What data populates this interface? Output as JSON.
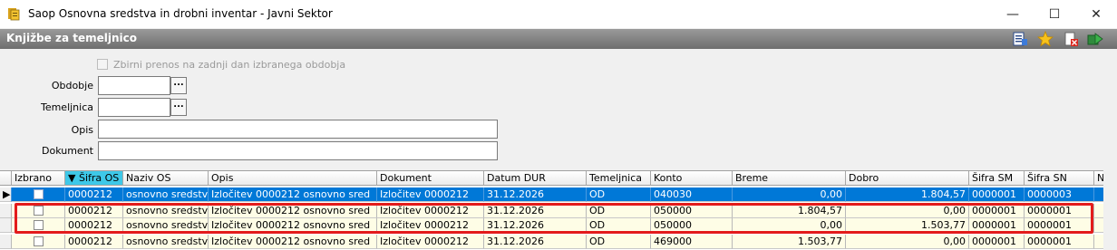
{
  "window": {
    "title": "Saop Osnovna sredstva in drobni inventar - Javni Sektor",
    "controls": {
      "minimize": "—",
      "maximize": "☐",
      "close": "✕"
    }
  },
  "panel": {
    "title": "Knjižbe za temeljnico",
    "toolbar_icons": [
      "list-icon",
      "star-icon",
      "delete-doc-icon",
      "export-icon"
    ]
  },
  "form": {
    "checkbox_label": "Zbirni prenos na zadnji dan izbranega obdobja",
    "fields": {
      "obdobje": {
        "label": "Obdobje",
        "value": ""
      },
      "temeljnica": {
        "label": "Temeljnica",
        "value": ""
      },
      "opis": {
        "label": "Opis",
        "value": ""
      },
      "dokument": {
        "label": "Dokument",
        "value": ""
      }
    },
    "browse_label": "..."
  },
  "grid": {
    "columns": [
      "Izbrano",
      "Šifra OS",
      "Naziv OS",
      "Opis",
      "Dokument",
      "Datum DUR",
      "Temeljnica",
      "Konto",
      "Breme",
      "Dobro",
      "Šifra SM",
      "Šifra SN",
      "N"
    ],
    "sorted_column": "Šifra OS",
    "rows": [
      {
        "sifra_os": "0000212",
        "naziv_os": "osnovno sredstvo",
        "opis": "Izločitev 0000212 osnovno sred",
        "dokument": "Izločitev 0000212",
        "datum": "31.12.2026",
        "temeljnica": "OD",
        "konto": "040030",
        "breme": "0,00",
        "dobro": "1.804,57",
        "sifra_sm": "0000001",
        "sifra_sn": "0000003",
        "selected": true
      },
      {
        "sifra_os": "0000212",
        "naziv_os": "osnovno sredstvo",
        "opis": "Izločitev 0000212 osnovno sred",
        "dokument": "Izločitev 0000212",
        "datum": "31.12.2026",
        "temeljnica": "OD",
        "konto": "050000",
        "breme": "1.804,57",
        "dobro": "0,00",
        "sifra_sm": "0000001",
        "sifra_sn": "0000001",
        "selected": false
      },
      {
        "sifra_os": "0000212",
        "naziv_os": "osnovno sredstvo",
        "opis": "Izločitev 0000212 osnovno sred",
        "dokument": "Izločitev 0000212",
        "datum": "31.12.2026",
        "temeljnica": "OD",
        "konto": "050000",
        "breme": "0,00",
        "dobro": "1.503,77",
        "sifra_sm": "0000001",
        "sifra_sn": "0000001",
        "selected": false
      },
      {
        "sifra_os": "0000212",
        "naziv_os": "osnovno sredstvo",
        "opis": "Izločitev 0000212 osnovno sred",
        "dokument": "Izločitev 0000212",
        "datum": "31.12.2026",
        "temeljnica": "OD",
        "konto": "469000",
        "breme": "1.503,77",
        "dobro": "0,00",
        "sifra_sm": "0000001",
        "sifra_sn": "0000001",
        "selected": false
      }
    ]
  },
  "colors": {
    "selection": "#0078d7",
    "row_background": "#fefde6",
    "sorted_header": "#3ec8e8",
    "highlight_border": "#e31b1b"
  }
}
